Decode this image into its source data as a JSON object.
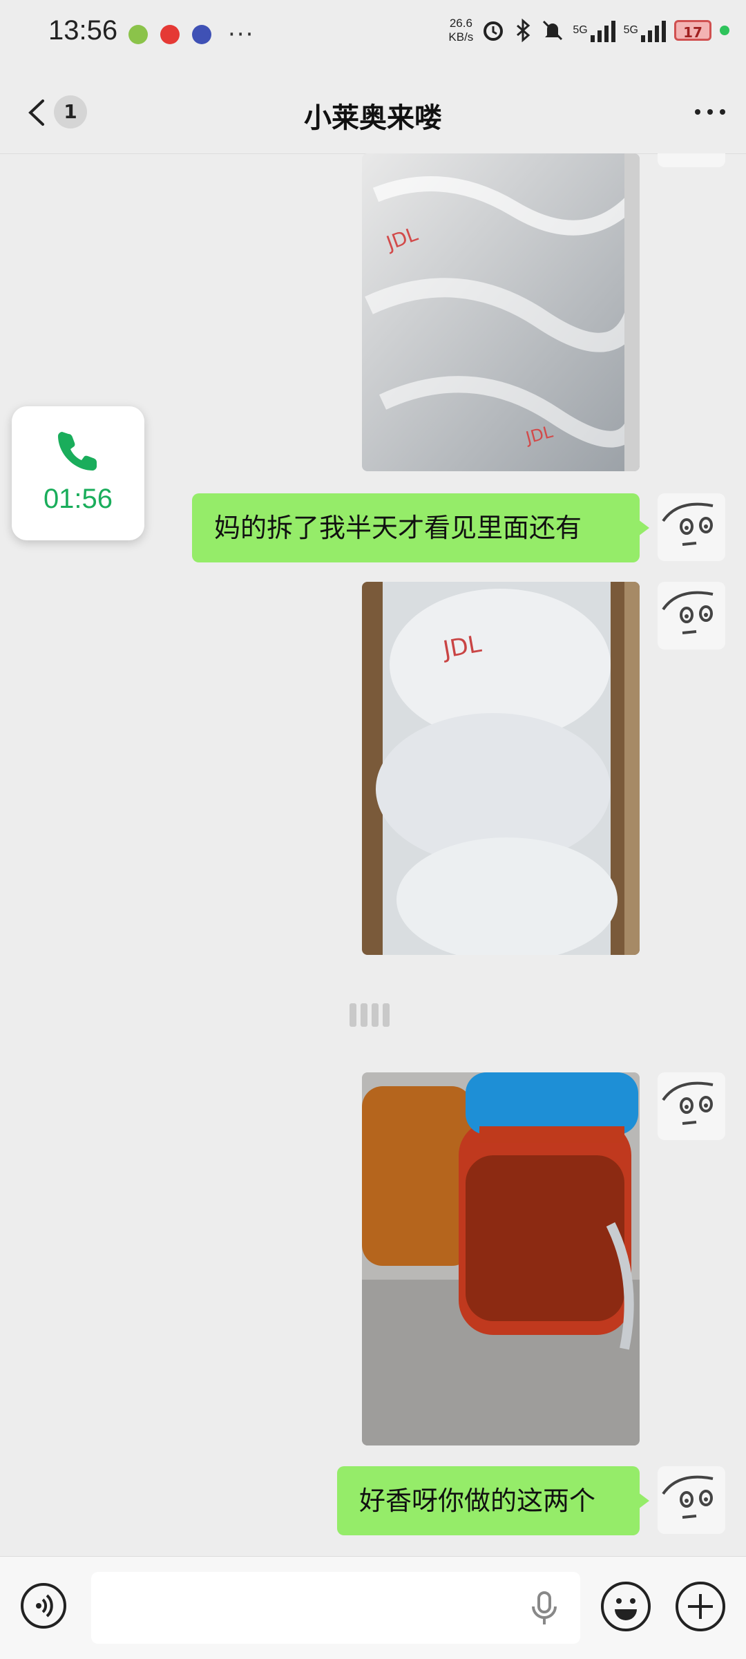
{
  "status_bar": {
    "time": "13:56",
    "net_speed_value": "26.6",
    "net_speed_unit": "KB/s",
    "network_1": "5G",
    "network_2": "5G",
    "battery": "17",
    "left_more": "···"
  },
  "header": {
    "unread_count": "1",
    "title": "小莱奥来喽",
    "icons": [
      "back-arrow-icon",
      "more-icon"
    ]
  },
  "messages": [
    {
      "type": "image",
      "from": "me",
      "description_icon": "photo-packaging-icon"
    },
    {
      "type": "text",
      "from": "me",
      "text": "妈的拆了我半天才看见里面还有"
    },
    {
      "type": "image",
      "from": "me",
      "description_icon": "photo-box-icon"
    },
    {
      "type": "voice-placeholder"
    },
    {
      "type": "image",
      "from": "me",
      "description_icon": "photo-jars-icon"
    },
    {
      "type": "text",
      "from": "me",
      "text": "好香呀你做的这两个"
    }
  ],
  "call_float": {
    "duration": "01:56",
    "icon": "phone-icon"
  },
  "input_bar": {
    "icons": [
      "voice-mode-icon",
      "microphone-icon",
      "emoji-icon",
      "plus-icon"
    ]
  },
  "colors": {
    "bubble": "#95ec69",
    "background": "#ededed",
    "call_green": "#1aad5b"
  }
}
